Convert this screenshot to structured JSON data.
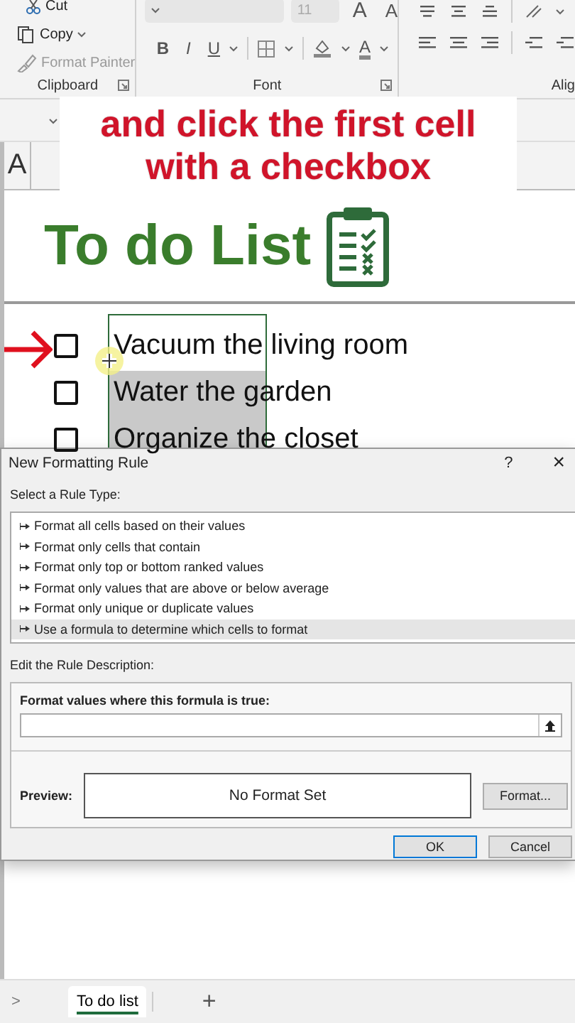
{
  "ribbon": {
    "clipboard": {
      "items": [
        {
          "label": "Cut",
          "disabled": false
        },
        {
          "label": "Copy",
          "disabled": false
        },
        {
          "label": "Format Painter",
          "disabled": true
        }
      ],
      "group_label": "Clipboard"
    },
    "font": {
      "size": "11",
      "grow": "A",
      "shrink": "A",
      "styles": [
        "B",
        "I",
        "U"
      ],
      "color_letter": "A",
      "group_label": "Font"
    },
    "alignment": {
      "group_label": "Alig"
    }
  },
  "caption": [
    "and click the first cell",
    "with a checkbox"
  ],
  "sheet": {
    "column_header": "A",
    "title": "To do List",
    "tasks": [
      {
        "text": "Vacuum the living room",
        "checked": false
      },
      {
        "text": "Water the garden",
        "checked": false
      },
      {
        "text": "Organize the closet",
        "checked": false
      }
    ]
  },
  "dialog": {
    "title": "New Formatting Rule",
    "help": "?",
    "close": "×",
    "rule_type_label": "Select a Rule Type:",
    "rule_types": [
      {
        "label": "Format all cells based on their values",
        "selected": false
      },
      {
        "label": "Format only cells that contain",
        "selected": false
      },
      {
        "label": "Format only top or bottom ranked values",
        "selected": false
      },
      {
        "label": "Format only values that are above or below average",
        "selected": false
      },
      {
        "label": "Format only unique or duplicate values",
        "selected": false
      },
      {
        "label": "Use a formula to determine which cells to format",
        "selected": true
      }
    ],
    "description_label": "Edit the Rule Description:",
    "formula_label": "Format values where this formula is true:",
    "preview_label": "Preview:",
    "preview_text": "No Format Set",
    "format_button": "Format...",
    "ok_button": "OK",
    "cancel_button": "Cancel"
  },
  "sheet_tabs": {
    "nav": ">",
    "tabs": [
      {
        "label": "To do list",
        "selected": true
      }
    ],
    "add": "+"
  }
}
